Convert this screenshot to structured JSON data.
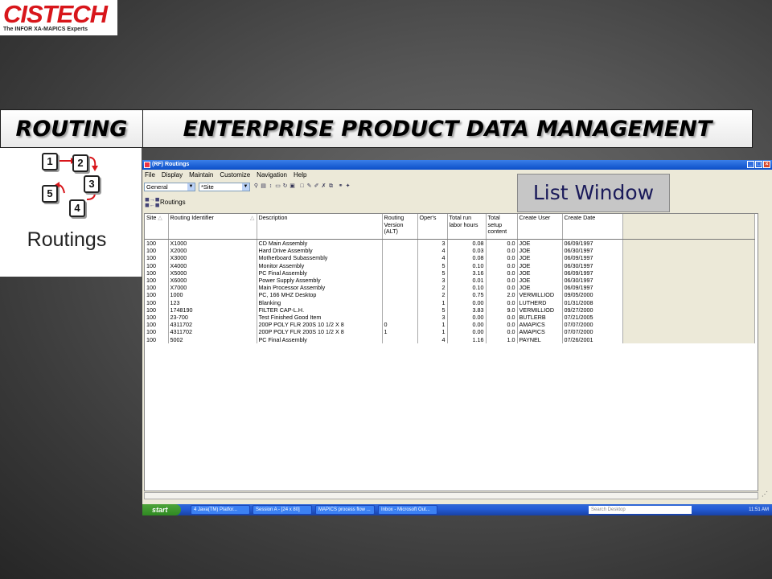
{
  "logo": {
    "name": "CISTECH",
    "tagline": "The INFOR XA-MAPICS Experts"
  },
  "header": {
    "left": "ROUTING",
    "right": "ENTERPRISE PRODUCT DATA MANAGEMENT"
  },
  "routings_icon": {
    "label": "Routings",
    "steps": [
      "1",
      "2",
      "3",
      "4",
      "5"
    ]
  },
  "callout": "List Window",
  "window": {
    "title": "(RF) Routings",
    "menu": [
      "File",
      "Display",
      "Maintain",
      "Customize",
      "Navigation",
      "Help"
    ],
    "view_select": "General",
    "site_select": "*Site",
    "breadcrumb": "Routings",
    "columns": [
      "Site",
      "Routing Identifier",
      "Description",
      "Routing Version (ALT)",
      "Oper's",
      "Total run labor hours",
      "Total setup content",
      "Create User",
      "Create Date"
    ],
    "rows": [
      [
        "100",
        "X1000",
        "CD Main Assembly",
        "",
        "3",
        "0.08",
        "0.0",
        "JOE",
        "06/09/1997"
      ],
      [
        "100",
        "X2000",
        "Hard Drive Assembly",
        "",
        "4",
        "0.03",
        "0.0",
        "JOE",
        "06/30/1997"
      ],
      [
        "100",
        "X3000",
        "Motherboard Subassembly",
        "",
        "4",
        "0.08",
        "0.0",
        "JOE",
        "06/09/1997"
      ],
      [
        "100",
        "X4000",
        "Monitor Assembly",
        "",
        "5",
        "0.10",
        "0.0",
        "JOE",
        "06/30/1997"
      ],
      [
        "100",
        "X5000",
        "PC Final Assembly",
        "",
        "5",
        "3.16",
        "0.0",
        "JOE",
        "06/09/1997"
      ],
      [
        "100",
        "X6000",
        "Power Supply Assembly",
        "",
        "3",
        "0.01",
        "0.0",
        "JOE",
        "06/30/1997"
      ],
      [
        "100",
        "X7000",
        "Main Processor Assembly",
        "",
        "2",
        "0.10",
        "0.0",
        "JOE",
        "06/09/1997"
      ],
      [
        "100",
        "1000",
        "PC, 166 MHZ Desktop",
        "",
        "2",
        "0.75",
        "2.0",
        "VERMILLIOD",
        "09/05/2000"
      ],
      [
        "100",
        "123",
        "Blanking",
        "",
        "1",
        "0.00",
        "0.0",
        "LUTHERD",
        "01/31/2008"
      ],
      [
        "100",
        "1748190",
        "FILTER CAP-L.H.",
        "",
        "5",
        "3.83",
        "9.0",
        "VERMILLIOD",
        "09/27/2000"
      ],
      [
        "100",
        "23-700",
        "Test Finished Good Item",
        "",
        "3",
        "0.00",
        "0.0",
        "BUTLERB",
        "07/21/2005"
      ],
      [
        "100",
        "4311702",
        "200P POLY FLR 200S 10 1/2 X 8",
        "0",
        "1",
        "0.00",
        "0.0",
        "AMAPICS",
        "07/07/2000"
      ],
      [
        "100",
        "4311702",
        "200P POLY FLR 200S 10 1/2 X 8",
        "1",
        "1",
        "0.00",
        "0.0",
        "AMAPICS",
        "07/07/2000"
      ],
      [
        "100",
        "5002",
        "PC Final Assembly",
        "",
        "4",
        "1.16",
        "1.0",
        "PAYNEL",
        "07/26/2001"
      ]
    ]
  },
  "taskbar": {
    "start": "start",
    "tasks": [
      "4 Java(TM) Platfor...",
      "Session A - [24 x 80]",
      "MAPICS process flow ...",
      "Inbox - Microsoft Out..."
    ],
    "search": "Search Desktop",
    "clock": "11:51 AM"
  }
}
